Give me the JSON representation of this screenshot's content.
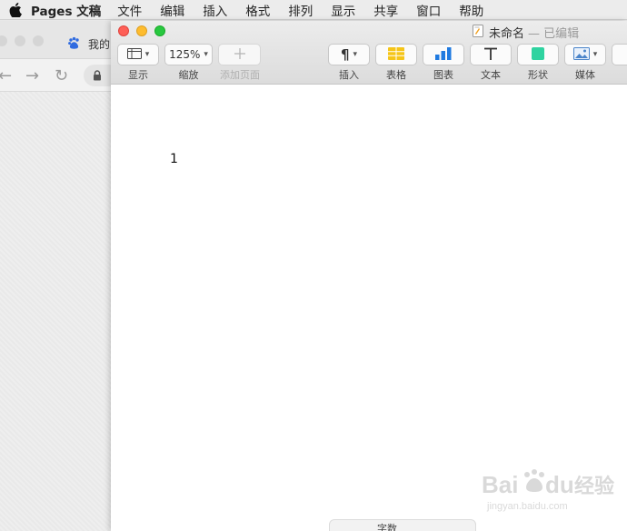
{
  "menubar": {
    "app_name": "Pages 文稿",
    "items": [
      "文件",
      "编辑",
      "插入",
      "格式",
      "排列",
      "显示",
      "共享",
      "窗口",
      "帮助"
    ]
  },
  "browser": {
    "tab_label": "我的"
  },
  "window": {
    "doc_title": "未命名",
    "doc_status": "— 已编辑"
  },
  "toolbar": {
    "view_label": "显示",
    "zoom_value": "125%",
    "zoom_label": "缩放",
    "add_page_label": "添加页面",
    "insert_label": "插入",
    "table_label": "表格",
    "chart_label": "图表",
    "text_label": "文本",
    "shape_label": "形状",
    "media_label": "媒体"
  },
  "document": {
    "content": "1"
  },
  "statusbar": {
    "word_count_label": "字数"
  },
  "colors": {
    "close": "#fe5f57",
    "minimize": "#febc2e",
    "zoom": "#28c840",
    "table_icon": "#f5c518",
    "chart_icon": "#1f7ae0",
    "shape_icon": "#2fd3a0"
  },
  "watermark": {
    "text": "Baidu经验",
    "sub": "jingyan.baidu.com"
  }
}
